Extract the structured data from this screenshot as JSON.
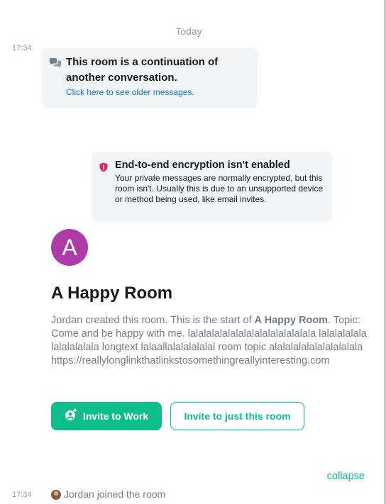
{
  "timeline": {
    "date_separator": "Today",
    "timestamp_1": "17:34",
    "timestamp_2": "17:34"
  },
  "continuation": {
    "title": "This room is a continuation of another conversation.",
    "link": "Click here to see older messages.",
    "icon": "chat-bubbles-icon"
  },
  "encryption": {
    "title": "End-to-end encryption isn't enabled",
    "description": "Your private messages are normally encrypted, but this room isn't. Usually this is due to an unsupported device or method being used, like email invites.",
    "icon": "shield-warning-icon",
    "icon_color": "#e0245e"
  },
  "room": {
    "avatar_letter": "A",
    "avatar_color": "#ac3ba8",
    "name": "A Happy Room",
    "intro_prefix": "Jordan created this room. This is the start of ",
    "intro_room_name": "A Happy Room",
    "intro_suffix": ".",
    "topic": "Topic: Come and be happy with me. lalalalalalalalalalalalalalalala lalalalalalalalalalalala longtext lalaallalalalalalal room topic alalalalalalalalalalala https://reallylonglinkthatlinkstosomethingreallyinteresting.com"
  },
  "actions": {
    "invite_work": "Invite to Work",
    "invite_room": "Invite to just this room",
    "accent": "#0dbd8b"
  },
  "events": {
    "collapse": "collapse",
    "joined": "Jordan joined the room"
  }
}
